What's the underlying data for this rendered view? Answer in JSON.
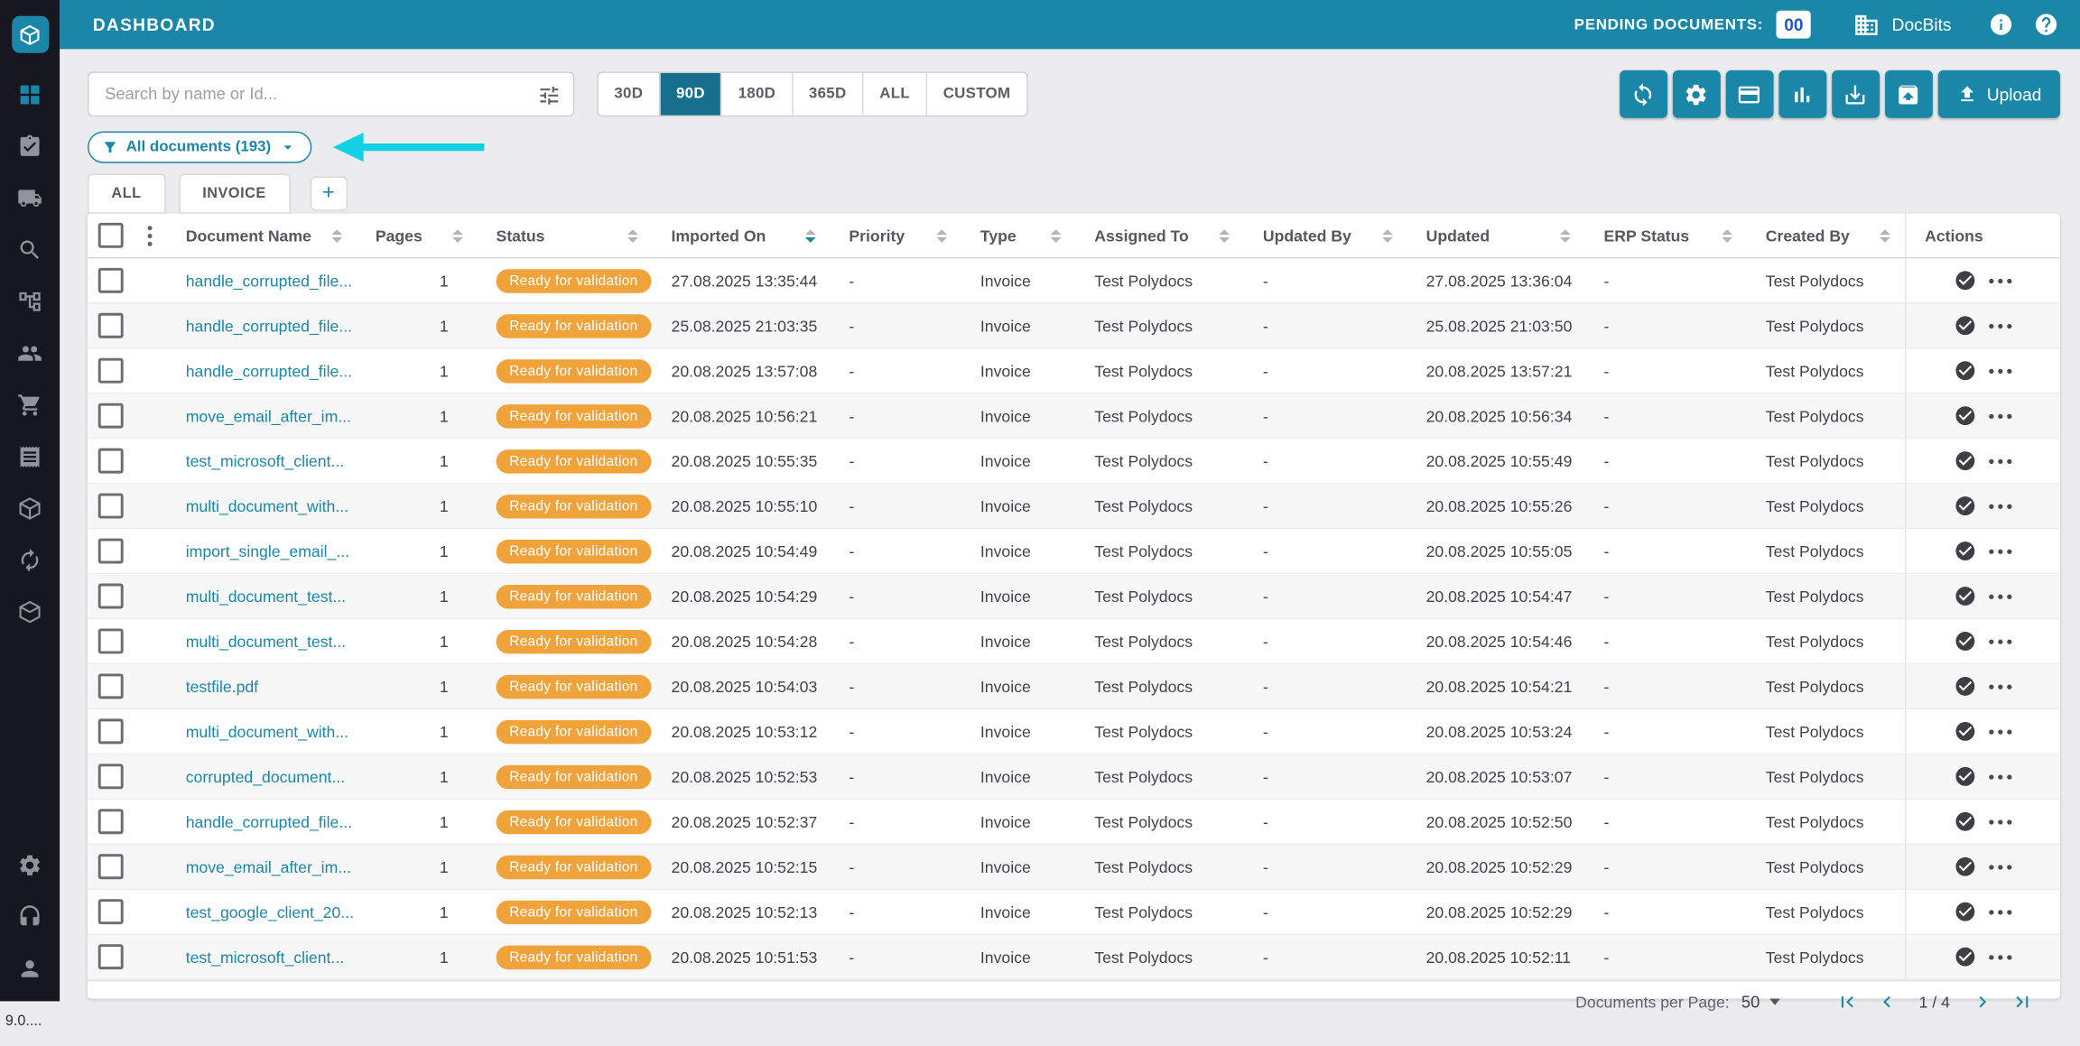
{
  "app": {
    "version": "9.0...."
  },
  "colors": {
    "accent": "#1a87a9",
    "accent_dark": "#156f8d",
    "header_bg": "#1a87a9",
    "sidebar_bg": "#17171f",
    "badge_orange": "#f1a33b",
    "arrow_cyan": "#12d1e5",
    "link": "#1a87a9"
  },
  "header": {
    "title": "DASHBOARD",
    "pending_label": "PENDING DOCUMENTS:",
    "pending_count": "00",
    "brand": "DocBits"
  },
  "toolbar": {
    "search_placeholder": "Search by name or Id...",
    "ranges": [
      "30D",
      "90D",
      "180D",
      "365D",
      "ALL",
      "CUSTOM"
    ],
    "selected_range": "90D",
    "upload_label": "Upload"
  },
  "filter_chip": {
    "label": "All documents (193)"
  },
  "tabs": {
    "items": [
      {
        "label": "ALL"
      },
      {
        "label": "INVOICE"
      }
    ],
    "add_label": "+"
  },
  "icons": {
    "sidebar": [
      "grid-icon",
      "clipboard-check-icon",
      "truck-icon",
      "search-icon",
      "workflow-icon",
      "users-icon",
      "cart-icon",
      "receipt-icon",
      "package-icon",
      "autorenew-icon",
      "box-icon",
      "gear-icon",
      "headset-icon",
      "user-icon"
    ],
    "toolbar": [
      "sync-icon",
      "gear-icon",
      "card-icon",
      "bar-chart-icon",
      "download-icon",
      "unarchive-icon",
      "upload-icon"
    ],
    "header": [
      "building-icon",
      "info-icon",
      "help-icon"
    ]
  },
  "table": {
    "columns": {
      "name": "Document Name",
      "pages": "Pages",
      "status": "Status",
      "imported": "Imported On",
      "priority": "Priority",
      "type": "Type",
      "assigned": "Assigned To",
      "updated_by": "Updated By",
      "updated": "Updated",
      "erp": "ERP Status",
      "created_by": "Created By",
      "actions": "Actions"
    },
    "rows": [
      {
        "name": "handle_corrupted_file...",
        "pages": "1",
        "status": "Ready for validation",
        "imported": "27.08.2025 13:35:44",
        "priority": "-",
        "type": "Invoice",
        "assigned": "Test Polydocs",
        "updated_by": "-",
        "updated": "27.08.2025 13:36:04",
        "erp": "-",
        "created_by": "Test Polydocs"
      },
      {
        "name": "handle_corrupted_file...",
        "pages": "1",
        "status": "Ready for validation",
        "imported": "25.08.2025 21:03:35",
        "priority": "-",
        "type": "Invoice",
        "assigned": "Test Polydocs",
        "updated_by": "-",
        "updated": "25.08.2025 21:03:50",
        "erp": "-",
        "created_by": "Test Polydocs"
      },
      {
        "name": "handle_corrupted_file...",
        "pages": "1",
        "status": "Ready for validation",
        "imported": "20.08.2025 13:57:08",
        "priority": "-",
        "type": "Invoice",
        "assigned": "Test Polydocs",
        "updated_by": "-",
        "updated": "20.08.2025 13:57:21",
        "erp": "-",
        "created_by": "Test Polydocs"
      },
      {
        "name": "move_email_after_im...",
        "pages": "1",
        "status": "Ready for validation",
        "imported": "20.08.2025 10:56:21",
        "priority": "-",
        "type": "Invoice",
        "assigned": "Test Polydocs",
        "updated_by": "-",
        "updated": "20.08.2025 10:56:34",
        "erp": "-",
        "created_by": "Test Polydocs"
      },
      {
        "name": "test_microsoft_client...",
        "pages": "1",
        "status": "Ready for validation",
        "imported": "20.08.2025 10:55:35",
        "priority": "-",
        "type": "Invoice",
        "assigned": "Test Polydocs",
        "updated_by": "-",
        "updated": "20.08.2025 10:55:49",
        "erp": "-",
        "created_by": "Test Polydocs"
      },
      {
        "name": "multi_document_with...",
        "pages": "1",
        "status": "Ready for validation",
        "imported": "20.08.2025 10:55:10",
        "priority": "-",
        "type": "Invoice",
        "assigned": "Test Polydocs",
        "updated_by": "-",
        "updated": "20.08.2025 10:55:26",
        "erp": "-",
        "created_by": "Test Polydocs"
      },
      {
        "name": "import_single_email_...",
        "pages": "1",
        "status": "Ready for validation",
        "imported": "20.08.2025 10:54:49",
        "priority": "-",
        "type": "Invoice",
        "assigned": "Test Polydocs",
        "updated_by": "-",
        "updated": "20.08.2025 10:55:05",
        "erp": "-",
        "created_by": "Test Polydocs"
      },
      {
        "name": "multi_document_test...",
        "pages": "1",
        "status": "Ready for validation",
        "imported": "20.08.2025 10:54:29",
        "priority": "-",
        "type": "Invoice",
        "assigned": "Test Polydocs",
        "updated_by": "-",
        "updated": "20.08.2025 10:54:47",
        "erp": "-",
        "created_by": "Test Polydocs"
      },
      {
        "name": "multi_document_test...",
        "pages": "1",
        "status": "Ready for validation",
        "imported": "20.08.2025 10:54:28",
        "priority": "-",
        "type": "Invoice",
        "assigned": "Test Polydocs",
        "updated_by": "-",
        "updated": "20.08.2025 10:54:46",
        "erp": "-",
        "created_by": "Test Polydocs"
      },
      {
        "name": "testfile.pdf",
        "pages": "1",
        "status": "Ready for validation",
        "imported": "20.08.2025 10:54:03",
        "priority": "-",
        "type": "Invoice",
        "assigned": "Test Polydocs",
        "updated_by": "-",
        "updated": "20.08.2025 10:54:21",
        "erp": "-",
        "created_by": "Test Polydocs"
      },
      {
        "name": "multi_document_with...",
        "pages": "1",
        "status": "Ready for validation",
        "imported": "20.08.2025 10:53:12",
        "priority": "-",
        "type": "Invoice",
        "assigned": "Test Polydocs",
        "updated_by": "-",
        "updated": "20.08.2025 10:53:24",
        "erp": "-",
        "created_by": "Test Polydocs"
      },
      {
        "name": "corrupted_document...",
        "pages": "1",
        "status": "Ready for validation",
        "imported": "20.08.2025 10:52:53",
        "priority": "-",
        "type": "Invoice",
        "assigned": "Test Polydocs",
        "updated_by": "-",
        "updated": "20.08.2025 10:53:07",
        "erp": "-",
        "created_by": "Test Polydocs"
      },
      {
        "name": "handle_corrupted_file...",
        "pages": "1",
        "status": "Ready for validation",
        "imported": "20.08.2025 10:52:37",
        "priority": "-",
        "type": "Invoice",
        "assigned": "Test Polydocs",
        "updated_by": "-",
        "updated": "20.08.2025 10:52:50",
        "erp": "-",
        "created_by": "Test Polydocs"
      },
      {
        "name": "move_email_after_im...",
        "pages": "1",
        "status": "Ready for validation",
        "imported": "20.08.2025 10:52:15",
        "priority": "-",
        "type": "Invoice",
        "assigned": "Test Polydocs",
        "updated_by": "-",
        "updated": "20.08.2025 10:52:29",
        "erp": "-",
        "created_by": "Test Polydocs"
      },
      {
        "name": "test_google_client_20...",
        "pages": "1",
        "status": "Ready for validation",
        "imported": "20.08.2025 10:52:13",
        "priority": "-",
        "type": "Invoice",
        "assigned": "Test Polydocs",
        "updated_by": "-",
        "updated": "20.08.2025 10:52:29",
        "erp": "-",
        "created_by": "Test Polydocs"
      },
      {
        "name": "test_microsoft_client...",
        "pages": "1",
        "status": "Ready for validation",
        "imported": "20.08.2025 10:51:53",
        "priority": "-",
        "type": "Invoice",
        "assigned": "Test Polydocs",
        "updated_by": "-",
        "updated": "20.08.2025 10:52:11",
        "erp": "-",
        "created_by": "Test Polydocs"
      }
    ]
  },
  "pagination": {
    "per_page_label": "Documents per Page:",
    "per_page_value": "50",
    "page_indicator": "1 / 4"
  }
}
